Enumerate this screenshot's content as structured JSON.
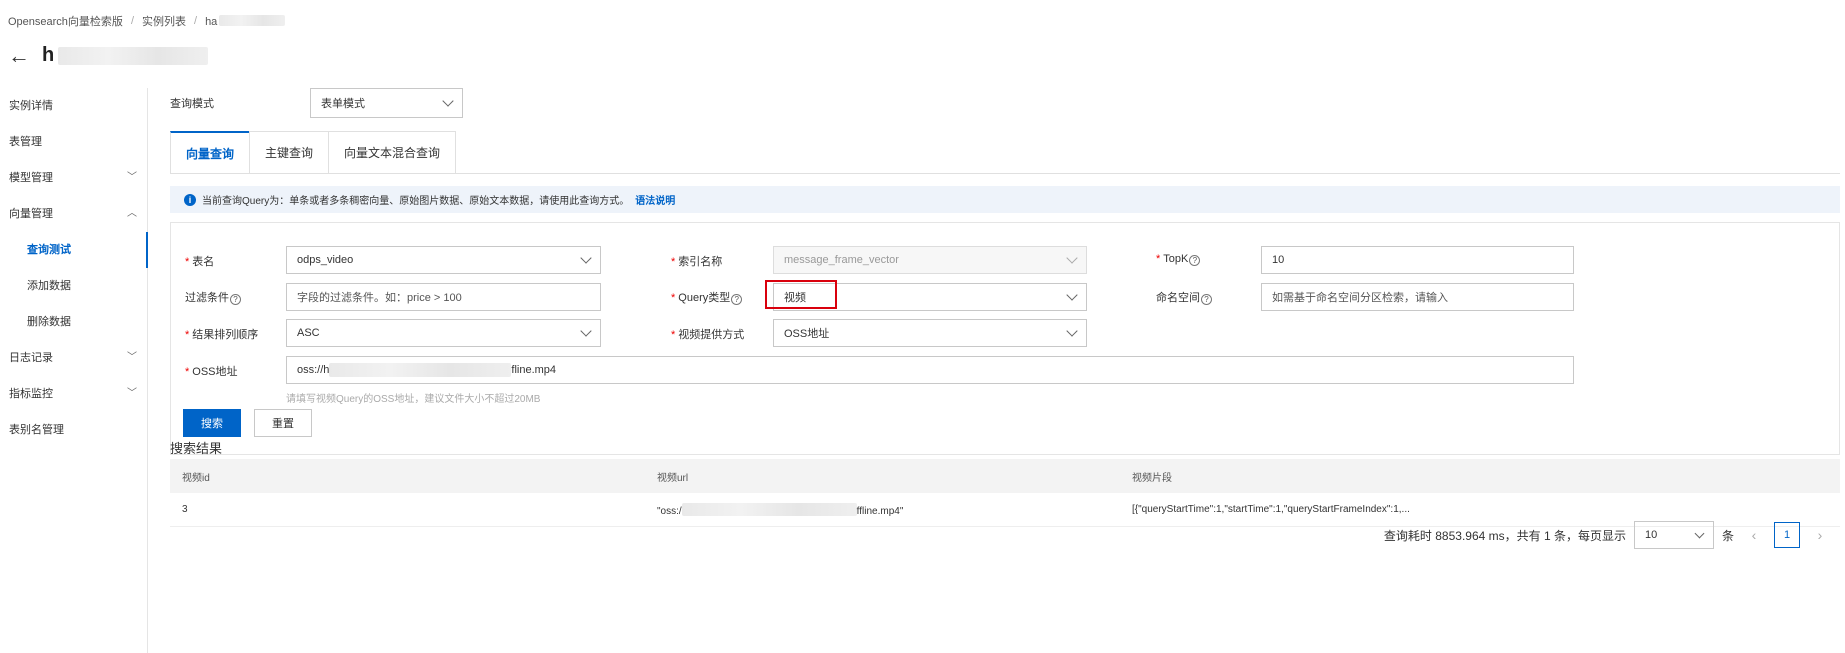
{
  "breadcrumb": {
    "items": [
      "Opensearch向量检索版",
      "实例列表",
      "ha"
    ]
  },
  "page": {
    "title": "h"
  },
  "sidebar": {
    "items": [
      {
        "label": "实例详情"
      },
      {
        "label": "表管理"
      },
      {
        "label": "模型管理"
      },
      {
        "label": "向量管理"
      },
      {
        "label": "查询测试"
      },
      {
        "label": "添加数据"
      },
      {
        "label": "删除数据"
      },
      {
        "label": "日志记录"
      },
      {
        "label": "指标监控"
      },
      {
        "label": "表别名管理"
      }
    ]
  },
  "query_mode": {
    "label": "查询模式",
    "value": "表单模式"
  },
  "tabs": [
    "向量查询",
    "主键查询",
    "向量文本混合查询"
  ],
  "notice": {
    "text": "当前查询Query为：单条或者多条稠密向量、原始图片数据、原始文本数据，请使用此查询方式。",
    "link": "语法说明"
  },
  "form": {
    "table_name": {
      "label": "表名",
      "value": "odps_video"
    },
    "index_name": {
      "label": "索引名称",
      "value": "message_frame_vector"
    },
    "topk": {
      "label": "TopK",
      "value": "10"
    },
    "filter": {
      "label": "过滤条件",
      "placeholder": "字段的过滤条件。如：price > 100"
    },
    "query_type": {
      "label": "Query类型",
      "value": "视频"
    },
    "namespace": {
      "label": "命名空间",
      "placeholder": "如需基于命名空间分区检索，请输入"
    },
    "sort_order": {
      "label": "结果排列顺序",
      "value": "ASC"
    },
    "video_source": {
      "label": "视频提供方式",
      "value": "OSS地址"
    },
    "oss_address": {
      "label": "OSS地址",
      "value_prefix": "oss://h",
      "value_suffix": "fline.mp4",
      "hint": "请填写视频Query的OSS地址，建议文件大小不超过20MB"
    },
    "search_button": "搜索",
    "reset_button": "重置"
  },
  "results": {
    "title": "搜索结果",
    "columns": [
      "视频id",
      "视频url",
      "视频片段"
    ],
    "rows": [
      {
        "id": "3",
        "url_prefix": "\"oss:/",
        "url_suffix": "ffline.mp4\"",
        "segment": "[{\"queryStartTime\":1,\"startTime\":1,\"queryStartFrameIndex\":1,..."
      }
    ]
  },
  "pagination": {
    "summary": "查询耗时 8853.964 ms，共有 1 条，每页显示",
    "page_size": "10",
    "unit": "条",
    "current_page": "1"
  }
}
